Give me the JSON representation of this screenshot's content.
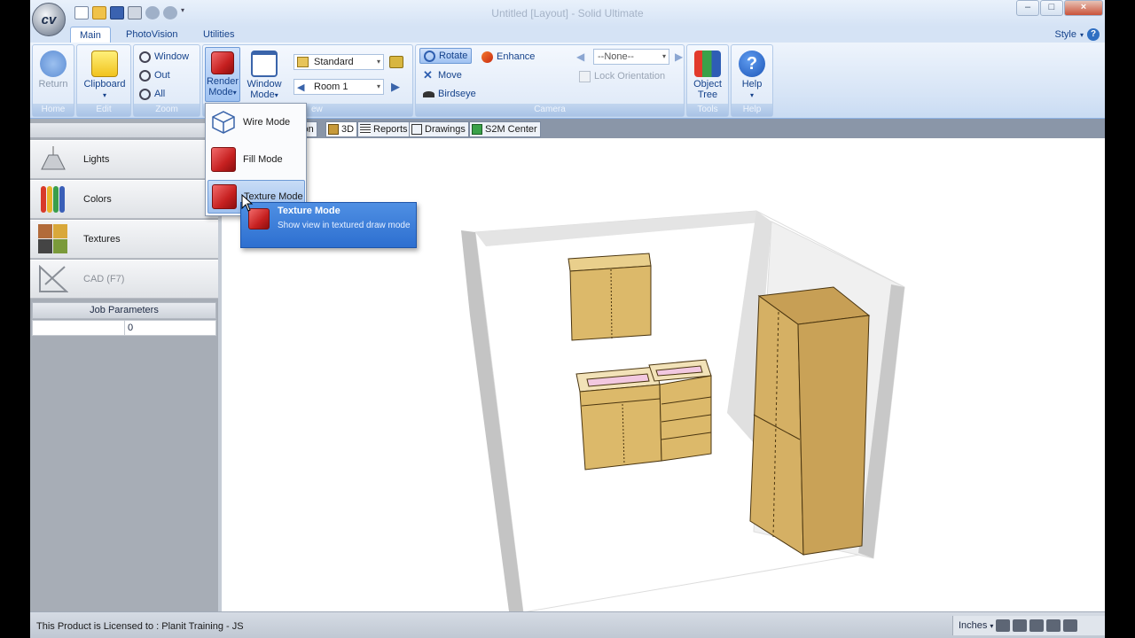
{
  "window": {
    "title": "Untitled [Layout] - Solid Ultimate",
    "logo": "cv",
    "min": "–",
    "max": "□",
    "close": "×"
  },
  "tabs": [
    {
      "label": "Main",
      "active": true
    },
    {
      "label": "PhotoVision"
    },
    {
      "label": "Utilities"
    }
  ],
  "style_menu": {
    "label": "Style",
    "icon": "help-icon",
    "mark": "?"
  },
  "ribbon": {
    "home": {
      "group": "Home",
      "return": "Return"
    },
    "edit": {
      "group": "Edit",
      "clipboard": "Clipboard"
    },
    "zoom": {
      "group": "Zoom",
      "window": "Window",
      "out": "Out",
      "all": "All"
    },
    "view": {
      "group": "View",
      "group_visible": "ew",
      "render_mode": [
        "Render",
        "Mode"
      ],
      "window_mode": [
        "Window",
        "Mode"
      ],
      "standard": "Standard",
      "room": "Room 1"
    },
    "camera": {
      "group": "Camera",
      "rotate": "Rotate",
      "move": "Move",
      "birdseye": "Birdseye",
      "enhance": "Enhance",
      "none": "--None--",
      "lock": "Lock Orientation"
    },
    "tools": {
      "group": "Tools",
      "object_tree": [
        "Object",
        "Tree"
      ]
    },
    "help": {
      "group": "Help",
      "help": "Help"
    }
  },
  "doc_tabs": [
    "tion",
    "3D",
    "Reports",
    "Drawings",
    "S2M Center"
  ],
  "left_panel": {
    "items": [
      {
        "label": "Lights"
      },
      {
        "label": "Colors"
      },
      {
        "label": "Textures"
      },
      {
        "label": "CAD (F7)",
        "disabled": true
      }
    ],
    "job_parameters": {
      "header": "Job Parameters",
      "value": "0"
    }
  },
  "render_menu": {
    "items": [
      {
        "label": "Wire Mode"
      },
      {
        "label": "Fill Mode"
      },
      {
        "label": "Texture Mode",
        "selected": true
      }
    ]
  },
  "tooltip": {
    "title": "Texture Mode",
    "description": "Show view in textured draw mode"
  },
  "status": {
    "license": "This Product is Licensed to : Planit Training - JS",
    "units": "Inches"
  },
  "colors": {
    "ribbon": "#d6e4f6",
    "accent": "#15428b",
    "wood": "#dcb96a",
    "tooltip": "#3b7ad9"
  }
}
